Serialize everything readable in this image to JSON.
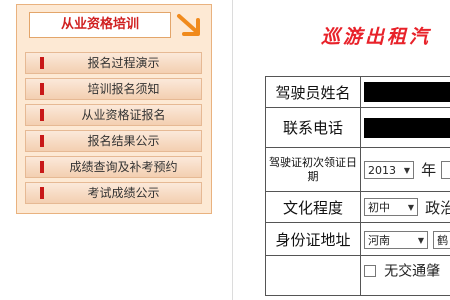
{
  "sidebar": {
    "header": "从业资格培训",
    "items": [
      {
        "label": "报名过程演示"
      },
      {
        "label": "培训报名须知"
      },
      {
        "label": "从业资格证报名"
      },
      {
        "label": "报名结果公示"
      },
      {
        "label": "成绩查询及补考预约"
      },
      {
        "label": "考试成绩公示"
      }
    ]
  },
  "form": {
    "title": "巡游出租汽",
    "fields": {
      "driver_name": {
        "label": "驾驶员姓名"
      },
      "phone": {
        "label": "联系电话"
      },
      "license_date": {
        "label": "驾驶证初次领证日期",
        "year": "2013",
        "year_unit": "年"
      },
      "education": {
        "label": "文化程度",
        "value": "初中",
        "trailing": "政治"
      },
      "id_address": {
        "label": "身份证地址",
        "province": "河南",
        "trailing": "鹤"
      },
      "no_violation": {
        "label": "无交通肇"
      }
    }
  },
  "colors": {
    "accent": "#e8222a",
    "sidebar_bg": "#fde9d4",
    "arrow": "#f08a1c"
  }
}
